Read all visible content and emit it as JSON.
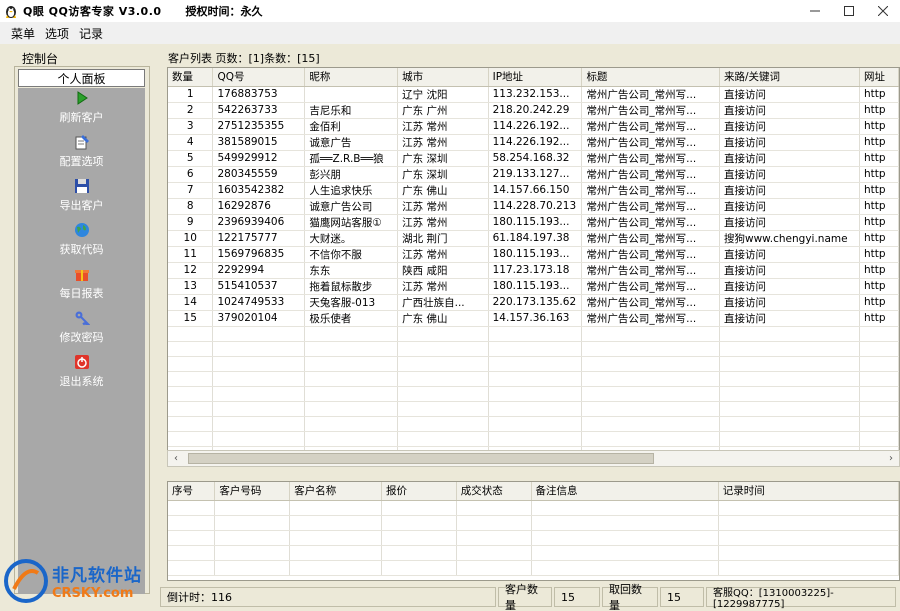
{
  "app": {
    "title": "Q眼 QQ访客专家 V3.0.0",
    "license": "授权时间：永久"
  },
  "menu": [
    "菜单",
    "选项",
    "记录"
  ],
  "sidebar": {
    "title": "控制台",
    "header": "个人面板",
    "items": [
      {
        "label": "刷新客户",
        "icon": "play-arrow-icon"
      },
      {
        "label": "配置选项",
        "icon": "edit-note-icon"
      },
      {
        "label": "导出客户",
        "icon": "floppy-disk-icon"
      },
      {
        "label": "获取代码",
        "icon": "globe-icon"
      },
      {
        "label": "每日报表",
        "icon": "gift-box-icon"
      },
      {
        "label": "修改密码",
        "icon": "key-icon"
      },
      {
        "label": "退出系统",
        "icon": "power-icon"
      }
    ]
  },
  "customer_list": {
    "caption": "客户列表 页数：[1]条数：[15]",
    "columns": [
      "数量",
      "QQ号",
      "昵称",
      "城市",
      "IP地址",
      "标题",
      "来路/关键词",
      "网址"
    ],
    "rows": [
      [
        "1",
        "176883753",
        "",
        "辽宁 沈阳",
        "113.232.153...",
        "常州广告公司_常州写...",
        "直接访问",
        "http"
      ],
      [
        "2",
        "542263733",
        "吉尼乐和",
        "广东 广州",
        "218.20.242.29",
        "常州广告公司_常州写...",
        "直接访问",
        "http"
      ],
      [
        "3",
        "2751235355",
        "金佰利",
        "江苏 常州",
        "114.226.192...",
        "常州广告公司_常州写...",
        "直接访问",
        "http"
      ],
      [
        "4",
        "381589015",
        "诚意广告",
        "江苏 常州",
        "114.226.192...",
        "常州广告公司_常州写...",
        "直接访问",
        "http"
      ],
      [
        "5",
        "549929912",
        "孤══Z.R.B══狼",
        "广东 深圳",
        "58.254.168.32",
        "常州广告公司_常州写...",
        "直接访问",
        "http"
      ],
      [
        "6",
        "280345559",
        "彭兴朋",
        "广东 深圳",
        "219.133.127...",
        "常州广告公司_常州写...",
        "直接访问",
        "http"
      ],
      [
        "7",
        "1603542382",
        "人生追求快乐",
        "广东 佛山",
        "14.157.66.150",
        "常州广告公司_常州写...",
        "直接访问",
        "http"
      ],
      [
        "8",
        "16292876",
        "诚意广告公司",
        "江苏 常州",
        "114.228.70.213",
        "常州广告公司_常州写...",
        "直接访问",
        "http"
      ],
      [
        "9",
        "2396939406",
        "猫鹰网站客服①",
        "江苏 常州",
        "180.115.193...",
        "常州广告公司_常州写...",
        "直接访问",
        "http"
      ],
      [
        "10",
        "122175777",
        "大财迷。",
        "湖北 荆门",
        "61.184.197.38",
        "常州广告公司_常州写...",
        "搜狗www.chengyi.name",
        "http"
      ],
      [
        "11",
        "1569796835",
        "不信你不服",
        "江苏 常州",
        "180.115.193...",
        "常州广告公司_常州写...",
        "直接访问",
        "http"
      ],
      [
        "12",
        "2292994",
        "东东",
        "陕西 咸阳",
        "117.23.173.18",
        "常州广告公司_常州写...",
        "直接访问",
        "http"
      ],
      [
        "13",
        "515410537",
        "拖着鼠标散步",
        "江苏 常州",
        "180.115.193...",
        "常州广告公司_常州写...",
        "直接访问",
        "http"
      ],
      [
        "14",
        "1024749533",
        "天兔客服-013",
        "广西壮族自...",
        "220.173.135.62",
        "常州广告公司_常州写...",
        "直接访问",
        "http"
      ],
      [
        "15",
        "379020104",
        "极乐使者",
        "广东 佛山",
        "14.157.36.163",
        "常州广告公司_常州写...",
        "直接访问",
        "http"
      ]
    ]
  },
  "records": {
    "columns": [
      "序号",
      "客户号码",
      "客户名称",
      "报价",
      "成交状态",
      "备注信息",
      "记录时间"
    ]
  },
  "status": {
    "countdown": "倒计时：116",
    "customer_count_label": "客户数量",
    "customer_count": "15",
    "fetched_count_label": "取回数量",
    "fetched_count": "15",
    "service_qq": "客服QQ：[1310003225]-[1229987775]"
  },
  "watermark": {
    "cn": "非凡软件站",
    "en": "CRSKY.com",
    "overlay": "Q眼 QQ访客专家"
  }
}
